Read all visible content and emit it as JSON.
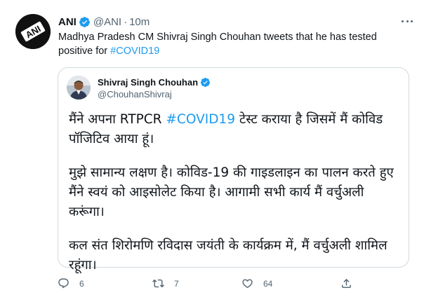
{
  "tweet": {
    "author_name": "ANI",
    "author_handle": "@ANI",
    "separator": "·",
    "time": "10m",
    "text_prefix": "Madhya Pradesh CM Shivraj Singh Chouhan tweets that he has tested positive for ",
    "hashtag": "#COVID19",
    "avatar_label": "ANI",
    "icons": {
      "verified": "verified-badge-icon",
      "more": "more-options-icon",
      "reply": "reply-icon",
      "retweet": "retweet-icon",
      "like": "heart-icon",
      "share": "share-icon"
    },
    "accent_color": "#1d9bf0",
    "stats": {
      "replies": "6",
      "retweets": "7",
      "likes": "64"
    }
  },
  "quoted_tweet": {
    "author_name": "Shivraj Singh Chouhan",
    "author_handle": "@ChouhanShivraj",
    "para1_before": "मैंने अपना RTPCR ",
    "para1_hashtag": "#COVID19",
    "para1_after": " टेस्ट कराया है जिसमें मैं कोविड पॉजिटिव आया हूं।",
    "para2": "मुझे सामान्य लक्षण है। कोविड-19 की गाइडलाइन का पालन करते हुए मैंने स्वयं को आइसोलेट किया है। आगामी सभी कार्य मैं वर्चुअली करूंगा।",
    "para3": "कल संत शिरोमणि रविदास जयंती के कार्यक्रम में, मैं वर्चुअली शामिल रहूंगा।"
  }
}
